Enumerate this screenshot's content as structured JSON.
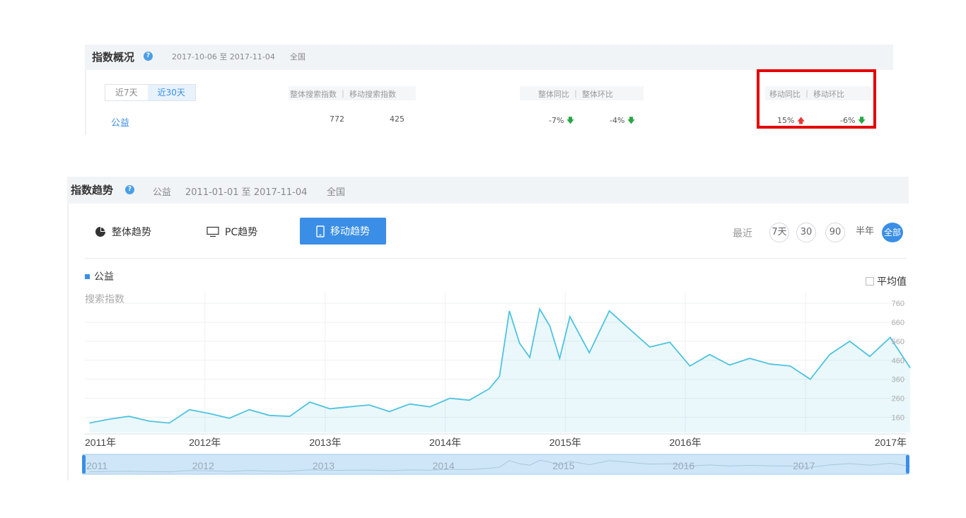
{
  "overview": {
    "title": "指数概况",
    "help_icon": "question-icon",
    "date_range": "2017-10-06 至 2017-11-04",
    "region": "全国",
    "tabs": [
      {
        "label": "近7天",
        "active": false
      },
      {
        "label": "近30天",
        "active": true
      }
    ],
    "col_search": "整体搜索指数 ｜ 移动搜索指数",
    "col_total": "整体同比 ｜ 整体环比",
    "col_mobile": "移动同比 ｜ 移动环比",
    "keyword": "公益",
    "search_total": "772",
    "search_mobile": "425",
    "total_yoy": "-7%",
    "total_mom": "-4%",
    "mobile_yoy": "15%",
    "mobile_mom": "-6%",
    "highlight_color": "#e60000"
  },
  "trend": {
    "title": "指数趋势",
    "keyword": "公益",
    "date_range": "2011-01-01 至 2017-11-04",
    "region": "全国",
    "tabs": [
      {
        "label": "整体趋势",
        "icon": "pie-chart-icon",
        "active": false
      },
      {
        "label": "PC趋势",
        "icon": "monitor-icon",
        "active": false
      },
      {
        "label": "移动趋势",
        "icon": "mobile-icon",
        "active": true
      }
    ],
    "recent_label": "最近",
    "ranges": [
      "7天",
      "30",
      "90",
      "半年",
      "全部"
    ],
    "active_range": "全部",
    "legend": "公益",
    "average_label": "平均值",
    "accent": "#3a8ee6",
    "line_color": "#4fc3e0"
  },
  "chart_data": {
    "type": "area",
    "ylabel": "搜索指数",
    "xlabel": "",
    "ylim": [
      80,
      820
    ],
    "yticks": [
      160,
      260,
      360,
      460,
      560,
      660,
      760
    ],
    "xticks": [
      "2011年",
      "2012年",
      "2013年",
      "2014年",
      "2015年",
      "2016年",
      "2017年"
    ],
    "navigator_ticks": [
      "2011",
      "2012",
      "2013",
      "2014",
      "2015",
      "2016",
      "2017"
    ],
    "series": [
      {
        "name": "公益",
        "x": [
          "2011-01",
          "2011-03",
          "2011-05",
          "2011-07",
          "2011-09",
          "2011-11",
          "2012-01",
          "2012-03",
          "2012-05",
          "2012-07",
          "2012-09",
          "2012-11",
          "2013-01",
          "2013-03",
          "2013-05",
          "2013-07",
          "2013-09",
          "2013-11",
          "2014-01",
          "2014-03",
          "2014-05",
          "2014-06",
          "2014-07",
          "2014-08",
          "2014-09",
          "2014-10",
          "2014-11",
          "2014-12",
          "2015-01",
          "2015-03",
          "2015-05",
          "2015-07",
          "2015-09",
          "2015-11",
          "2016-01",
          "2016-03",
          "2016-05",
          "2016-07",
          "2016-09",
          "2016-11",
          "2017-01",
          "2017-03",
          "2017-05",
          "2017-07",
          "2017-09",
          "2017-11"
        ],
        "values": [
          130,
          150,
          165,
          140,
          130,
          200,
          180,
          155,
          200,
          170,
          165,
          240,
          205,
          215,
          225,
          190,
          230,
          215,
          260,
          250,
          310,
          375,
          720,
          550,
          475,
          730,
          640,
          470,
          690,
          500,
          720,
          625,
          530,
          555,
          430,
          490,
          435,
          470,
          440,
          430,
          360,
          490,
          560,
          480,
          580,
          420
        ]
      }
    ]
  }
}
